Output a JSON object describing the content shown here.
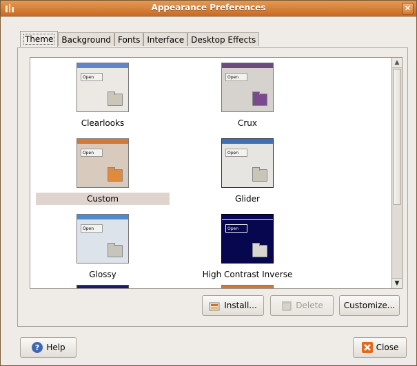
{
  "window": {
    "title": "Appearance Preferences",
    "close_glyph": "×"
  },
  "tabs": [
    {
      "label": "Theme",
      "active": true
    },
    {
      "label": "Background",
      "active": false
    },
    {
      "label": "Fonts",
      "active": false
    },
    {
      "label": "Interface",
      "active": false
    },
    {
      "label": "Desktop Effects",
      "active": false
    }
  ],
  "themes": [
    {
      "name": "Clearlooks",
      "preview_button": "Open",
      "titlebar_color": "#5f86c9",
      "body_color": "#ece9e4",
      "folder_color": "#cbc6b7",
      "selected": false
    },
    {
      "name": "Crux",
      "preview_button": "Open",
      "titlebar_color": "#6b4a7d",
      "body_color": "#d6d3cf",
      "folder_color": "#7a4a8c",
      "selected": false
    },
    {
      "name": "Custom",
      "preview_button": "Open",
      "titlebar_color": "#d47834",
      "body_color": "#d8cbbe",
      "folder_color": "#e08a3c",
      "selected": true
    },
    {
      "name": "Glider",
      "preview_button": "Open",
      "titlebar_color": "#3f6fb6",
      "body_color": "#e6e5e1",
      "folder_color": "#c9c5b8",
      "selected": false
    },
    {
      "name": "Glossy",
      "preview_button": "Open",
      "titlebar_color": "#4f8ad0",
      "body_color": "#dde3ea",
      "folder_color": "#c6c4bb",
      "selected": false
    },
    {
      "name": "High Contrast Inverse",
      "preview_button": "Open",
      "titlebar_color": "#06065c",
      "body_color": "#07074f",
      "folder_color": "#d9d6cf",
      "selected": false
    }
  ],
  "buttons": {
    "install": "Install...",
    "delete": "Delete",
    "customize": "Customize...",
    "help": "Help",
    "close": "Close"
  },
  "icons": {
    "app": "appearance-icon",
    "install": "install-theme-icon",
    "delete": "delete-icon",
    "help": "help-icon",
    "close": "close-icon"
  }
}
